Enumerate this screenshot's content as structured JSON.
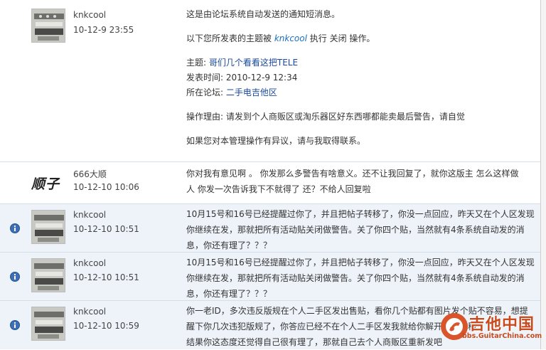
{
  "messages": [
    {
      "author": "knkcool",
      "time": "10-12-9 23:55",
      "line1": "这是由论坛系统自动发送的通知短消息。",
      "line2_pre": "以下您所发表的主题被 ",
      "line2_user": "knkcool",
      "line2_post": " 执行 关闭 操作。",
      "topic_label": "主题: ",
      "topic_link": "哥们几个看看这把TELE",
      "posted_label": "发表时间: 2010-12-9 12:34",
      "forum_label": "所在论坛: ",
      "forum_link": "二手电吉他区",
      "reason": "操作理由: 请发到个人商贩区或淘乐器区好东西哪都能卖最后警告，请自觉",
      "footer": "如果您对本管理操作有异议，请与我取得联系。"
    },
    {
      "author": "666大顺",
      "avatar_text": "顺子",
      "time": "10-12-10 10:06",
      "line1": "你对我有意见啊 。 你发那么多警告有啥意义。还不让我回复了，就你这版主 怎么这样做",
      "line2": "人   你发一次告诉我下不就得了 还？不给人回复啦"
    },
    {
      "author": "knkcool",
      "time": "10-12-10 10:51",
      "line1": "10月15号和16号已经提醒过你了，并且把帖子转移了，你没一点回应，昨天又在个人区发现",
      "line2": "你继续在发，那就把所有活动贴关闭做警告。关了你四个贴，当然就有4条系统自动发的消",
      "line3": "息，你还有理了？？？"
    },
    {
      "author": "knkcool",
      "time": "10-12-10 10:51",
      "line1": "10月15号和16号已经提醒过你了，并且把帖子转移了，你没一点回应，昨天又在个人区发现",
      "line2": "你继续在发，那就把所有活动贴关闭做警告。关了你四个贴，当然就有4条系统自动发的消",
      "line3": "息，你还有理了？？？"
    },
    {
      "author": "knkcool",
      "time": "10-12-10 10:59",
      "line1": "你一老ID，多次违反版规在个人二手区发出售贴，看你几个贴都有图片发个贴不容易，想提",
      "line2": "醒下你几次违犯版规了，你答应已经不在个人二手区发我就给你解开所有转移",
      "line3": "结果你这态度还觉得自己很有理了，那就自己去个人商贩区重新发吧"
    }
  ],
  "watermark": {
    "text": "吉他中国",
    "url": "bbs.GuitarChina.com"
  },
  "colors": {
    "highlight_row": "#eef3fa",
    "link": "#1a4a9c",
    "info_icon": "#3c6fb6",
    "watermark": "#c94a1e"
  }
}
